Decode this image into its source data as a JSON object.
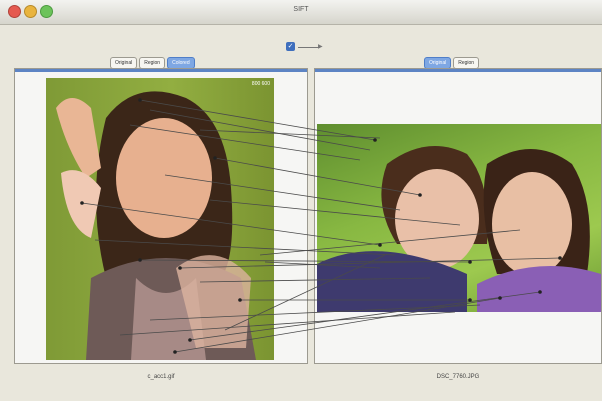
{
  "window": {
    "title": "SIFT"
  },
  "colors": {
    "tab_selected": "#7ea7e3",
    "panel_accent": "#5d84c4",
    "match_line": "#4a4a4a"
  },
  "left_panel": {
    "tabs": [
      {
        "label": "Original",
        "selected": false
      },
      {
        "label": "Region",
        "selected": false
      },
      {
        "label": "Colored",
        "selected": true
      }
    ],
    "image_corner_label": "800 600",
    "caption": "c_acc1.gif"
  },
  "center_control": {
    "checkbox_checked": true,
    "icon": "link-arrow-icon"
  },
  "right_panel": {
    "tabs": [
      {
        "label": "Original",
        "selected": true
      },
      {
        "label": "Region",
        "selected": false
      }
    ],
    "caption": "DSC_7760.JPG"
  }
}
